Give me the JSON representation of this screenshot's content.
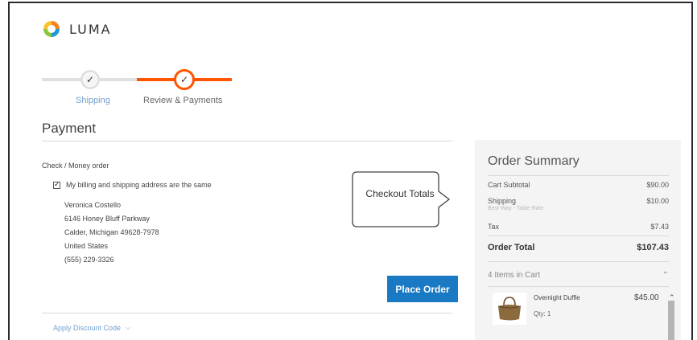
{
  "brand": {
    "name": "LUMA",
    "colors": {
      "accent": "#ff5501",
      "primary": "#1979c3"
    }
  },
  "progress": {
    "steps": [
      {
        "label": "Shipping",
        "icon": "check-icon",
        "state": "complete"
      },
      {
        "label": "Review & Payments",
        "icon": "check-icon",
        "state": "active"
      }
    ]
  },
  "payment": {
    "title": "Payment",
    "method": "Check / Money order",
    "same_address_label": "My billing and shipping address are the same",
    "same_address_checked": true,
    "address": {
      "name": "Veronica Costello",
      "street": "6146 Honey Bluff Parkway",
      "city_line": "Calder, Michigan 49628-7978",
      "country": "United States",
      "phone": "(555) 229-3326"
    },
    "place_order_label": "Place Order",
    "discount_label": "Apply Discount Code"
  },
  "callout": {
    "text": "Checkout Totals"
  },
  "summary": {
    "title": "Order Summary",
    "rows": [
      {
        "label": "Cart Subtotal",
        "value": "$90.00"
      },
      {
        "label": "Shipping",
        "value": "$10.00",
        "note": "Best Way - Table Rate"
      },
      {
        "label": "Tax",
        "value": "$7.43"
      }
    ],
    "total": {
      "label": "Order Total",
      "value": "$107.43"
    },
    "items_header": "4 Items in Cart",
    "item": {
      "name": "Overnight Duffle",
      "qty": "Qty: 1",
      "price": "$45.00"
    }
  }
}
